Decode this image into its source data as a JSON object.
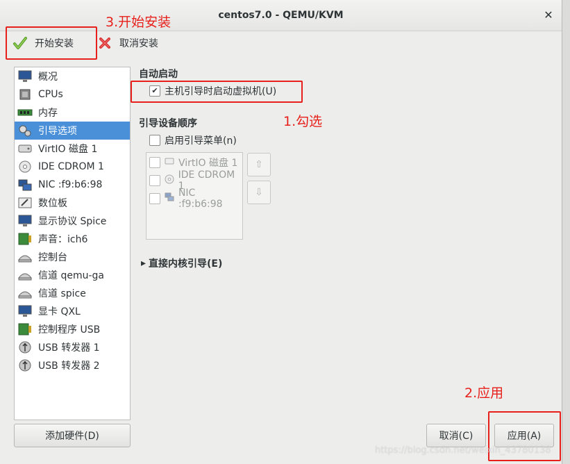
{
  "window": {
    "title": "centos7.0 - QEMU/KVM",
    "close_glyph": "✕"
  },
  "toolbar": {
    "begin_install": "开始安装",
    "cancel_install": "取消安装"
  },
  "sidebar": {
    "items": [
      {
        "label": "概况",
        "icon": "overview-monitor-icon"
      },
      {
        "label": "CPUs",
        "icon": "cpu-chip-icon"
      },
      {
        "label": "内存",
        "icon": "memory-module-icon"
      },
      {
        "label": "引导选项",
        "icon": "boot-options-gears-icon",
        "selected": true
      },
      {
        "label": "VirtIO 磁盘 1",
        "icon": "hard-disk-icon"
      },
      {
        "label": "IDE CDROM 1",
        "icon": "cdrom-disc-icon"
      },
      {
        "label": "NIC :f9:b6:98",
        "icon": "network-card-icon"
      },
      {
        "label": "数位板",
        "icon": "tablet-pen-icon"
      },
      {
        "label": "显示协议  Spice",
        "icon": "display-monitor-icon"
      },
      {
        "label": "声音：ich6",
        "icon": "sound-card-icon"
      },
      {
        "label": "控制台",
        "icon": "serial-console-icon"
      },
      {
        "label": "信道  qemu-ga",
        "icon": "channel-icon"
      },
      {
        "label": "信道  spice",
        "icon": "channel-icon"
      },
      {
        "label": "显卡  QXL",
        "icon": "video-card-icon"
      },
      {
        "label": "控制程序  USB",
        "icon": "usb-controller-icon"
      },
      {
        "label": "USB 转发器 1",
        "icon": "usb-redirector-icon"
      },
      {
        "label": "USB 转发器 2",
        "icon": "usb-redirector-icon"
      }
    ],
    "add_hardware": "添加硬件(D)"
  },
  "autostart": {
    "title": "自动启动",
    "checkbox_label": "主机引导时启动虚拟机(U)",
    "checked": true
  },
  "boot_order": {
    "title": "引导设备顺序",
    "enable_menu_label": "启用引导菜单(n)",
    "enable_menu_checked": false,
    "devices": [
      {
        "label": "VirtIO 磁盘 1",
        "icon": "hard-disk-icon"
      },
      {
        "label": "IDE CDROM 1",
        "icon": "cdrom-disc-icon"
      },
      {
        "label": "NIC :f9:b6:98",
        "icon": "network-card-icon"
      }
    ],
    "move_up_glyph": "⇧",
    "move_down_glyph": "⇩"
  },
  "direct_kernel": {
    "label": "直接内核引导(E)",
    "expander_glyph": "▸"
  },
  "buttons": {
    "cancel": "取消(C)",
    "apply": "应用(A)"
  },
  "annotations": {
    "step3": "3.开始安装",
    "step1": "1.勾选",
    "step2": "2.应用",
    "color": "#e8201b"
  },
  "watermark": "https://blog.csdn.net/weixin_43780138"
}
